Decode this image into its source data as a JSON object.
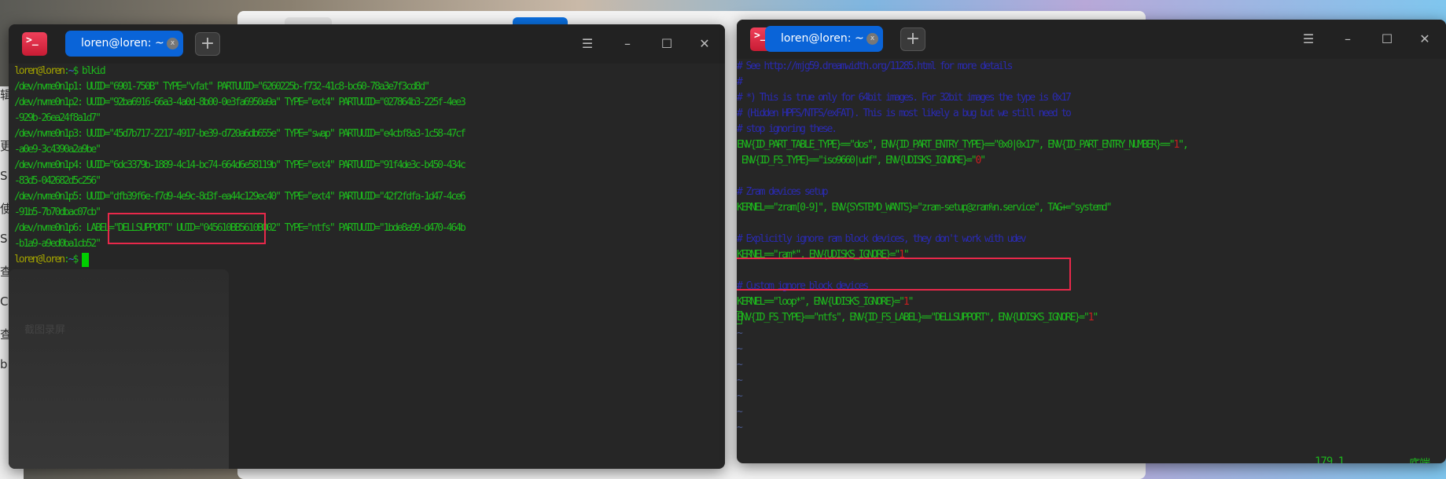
{
  "left_terminal": {
    "tab_title": "loren@loren: ~",
    "tab_close": "x",
    "new_tab": "+",
    "window_buttons": {
      "menu": "☰",
      "minimize": "–",
      "maximize": "☐",
      "close": "✕"
    },
    "lines": [
      [
        {
          "t": "loren@loren",
          "c": "u"
        },
        {
          "t": ":",
          "c": "g"
        },
        {
          "t": "~",
          "c": "b"
        },
        {
          "t": "$ blkid",
          "c": "g"
        }
      ],
      [
        {
          "t": "/dev/nvme0n1p1: UUID=\"6901-750B\" TYPE=\"vfat\" PARTUUID=\"6260225b-f732-41c8-bc60-78a3e7f3cd8d\"",
          "c": "g"
        }
      ],
      [
        {
          "t": "/dev/nvme0n1p2: UUID=\"92ba6916-66a3-4a0d-8b00-0e3fa6950a9a\" TYPE=\"ext4\" PARTUUID=\"027864b3-225f-4ee3",
          "c": "g"
        }
      ],
      [
        {
          "t": "-929b-26ea24f8a1d7\"",
          "c": "g"
        }
      ],
      [
        {
          "t": "/dev/nvme0n1p3: UUID=\"45d7b717-2217-4917-be39-d720a6db655e\" TYPE=\"swap\" PARTUUID=\"e4cbf8a3-1c58-47cf",
          "c": "g"
        }
      ],
      [
        {
          "t": "-a0e9-3c4390a2a9be\"",
          "c": "g"
        }
      ],
      [
        {
          "t": "/dev/nvme0n1p4: UUID=\"6dc3379b-1889-4c14-bc74-664d6e58119b\" TYPE=\"ext4\" PARTUUID=\"91f4de3c-b450-434c",
          "c": "g"
        }
      ],
      [
        {
          "t": "-83d5-042682d5c256\"",
          "c": "g"
        }
      ],
      [
        {
          "t": "/dev/nvme0n1p5: UUID=\"dfb39f6e-f7d9-4e9c-8d3f-ea44c129ec40\" TYPE=\"ext4\" PARTUUID=\"42f2fdfa-1d47-4ce6",
          "c": "g"
        }
      ],
      [
        {
          "t": "-91b5-7b70dbac07cb\"",
          "c": "g"
        }
      ],
      [
        {
          "t": "/dev/nvme0n1p6: LABEL=\"DELLSUPPORT\" UUID=\"045610BB5610B002\" TYPE=\"ntfs\" PARTUUID=\"1bde8a99-d470-464b",
          "c": "g"
        }
      ],
      [
        {
          "t": "-b1a9-a9ed0ba1cb52\"",
          "c": "g"
        }
      ],
      [
        {
          "t": "loren@loren",
          "c": "u"
        },
        {
          "t": ":",
          "c": "g"
        },
        {
          "t": "~",
          "c": "b"
        },
        {
          "t": "$ ",
          "c": "g"
        }
      ]
    ]
  },
  "right_terminal": {
    "tab_title": "loren@loren: ~",
    "tab_close": "x",
    "new_tab": "+",
    "window_buttons": {
      "menu": "☰",
      "minimize": "–",
      "maximize": "☐",
      "close": "✕"
    },
    "lines": [
      [
        {
          "t": "# See http://mjg59.dreamwidth.org/11285.html for more details",
          "c": "c"
        }
      ],
      [
        {
          "t": "#",
          "c": "c"
        }
      ],
      [
        {
          "t": "# *) This is true only for 64bit images. For 32bit images the type is 0x17",
          "c": "c"
        }
      ],
      [
        {
          "t": "# (Hidden HPFS/NTFS/exFAT). This is most likely a bug but we still need to",
          "c": "c"
        }
      ],
      [
        {
          "t": "# stop ignoring these.",
          "c": "c"
        }
      ],
      [
        {
          "t": "ENV{ID_PART_TABLE_TYPE}==\"dos\", ENV{ID_PART_ENTRY_TYPE}==\"0x0|0x17\", ENV{ID_PART_ENTRY_NUMBER}==\"",
          "c": "g"
        },
        {
          "t": "1",
          "c": "r"
        },
        {
          "t": "\",",
          "c": "g"
        }
      ],
      [
        {
          "t": " ENV{ID_FS_TYPE}==\"iso9660|udf\", ENV{UDISKS_IGNORE}=\"",
          "c": "g"
        },
        {
          "t": "0",
          "c": "r"
        },
        {
          "t": "\"",
          "c": "g"
        }
      ],
      [],
      [
        {
          "t": "# Zram devices setup",
          "c": "c"
        }
      ],
      [
        {
          "t": "KERNEL==\"zram[0-9]\", ENV{SYSTEMD_WANTS}=\"zram-setup@zram%n.service\", TAG+=\"systemd\"",
          "c": "g"
        }
      ],
      [],
      [
        {
          "t": "# Explicitly ignore ram block devices, they don't work with udev",
          "c": "c"
        }
      ],
      [
        {
          "t": "KERNEL==\"ram*\", ENV{UDISKS_IGNORE}=\"",
          "c": "g"
        },
        {
          "t": "1",
          "c": "r"
        },
        {
          "t": "\"",
          "c": "g"
        }
      ],
      [],
      [
        {
          "t": "# Custom ignore block devices",
          "c": "c"
        }
      ],
      [
        {
          "t": "KERNEL==\"loop*\", ENV{UDISKS_IGNORE}=\"",
          "c": "g"
        },
        {
          "t": "1",
          "c": "r"
        },
        {
          "t": "\"",
          "c": "g"
        }
      ],
      [
        {
          "t": "E",
          "c": "g vcur"
        },
        {
          "t": "NV{ID_FS_TYPE}==\"ntfs\", ENV{ID_FS_LABEL}==\"DELLSUPPORT\", ENV{UDISKS_IGNORE}=\"",
          "c": "g"
        },
        {
          "t": "1",
          "c": "r"
        },
        {
          "t": "\"",
          "c": "g"
        }
      ],
      [
        {
          "t": "~",
          "c": "t"
        }
      ],
      [
        {
          "t": "~",
          "c": "t"
        }
      ],
      [
        {
          "t": "~",
          "c": "t"
        }
      ],
      [
        {
          "t": "~",
          "c": "t"
        }
      ],
      [
        {
          "t": "~",
          "c": "t"
        }
      ],
      [
        {
          "t": "~",
          "c": "t"
        }
      ],
      [
        {
          "t": "~",
          "c": "t"
        }
      ]
    ],
    "status_position": "179,1",
    "status_scroll": "底端"
  },
  "background_window": {
    "left_fragments": [
      "辑(",
      "更新",
      "S",
      "使用",
      "S",
      "查看",
      "C",
      "查看",
      "b"
    ],
    "ghost_label": "截图录屏"
  }
}
